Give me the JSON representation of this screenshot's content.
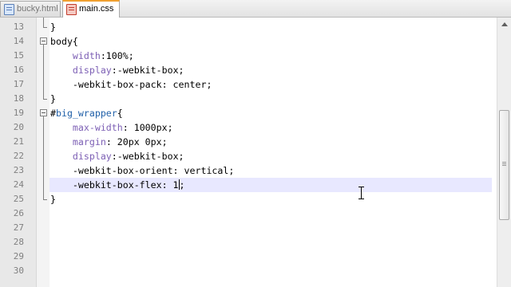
{
  "tabs": [
    {
      "label": "bucky.html",
      "active": false
    },
    {
      "label": "main.css",
      "active": true
    }
  ],
  "editor": {
    "lines": [
      {
        "num": "13",
        "parts": [
          {
            "t": "}",
            "c": "brace"
          }
        ]
      },
      {
        "num": "14",
        "parts": [
          {
            "t": "body",
            "c": "sel"
          },
          {
            "t": "{",
            "c": "brace"
          }
        ]
      },
      {
        "num": "15",
        "parts": [
          {
            "t": "    ",
            "c": "val"
          },
          {
            "t": "width",
            "c": "prop"
          },
          {
            "t": ":100%;",
            "c": "val"
          }
        ]
      },
      {
        "num": "16",
        "parts": [
          {
            "t": "    ",
            "c": "val"
          },
          {
            "t": "display",
            "c": "prop"
          },
          {
            "t": ":-webkit-box;",
            "c": "val"
          }
        ]
      },
      {
        "num": "17",
        "parts": [
          {
            "t": "    -webkit-box-pack: center;",
            "c": "val"
          }
        ]
      },
      {
        "num": "18",
        "parts": [
          {
            "t": "}",
            "c": "brace"
          }
        ]
      },
      {
        "num": "19",
        "parts": [
          {
            "t": "#",
            "c": "sel"
          },
          {
            "t": "big_wrapper",
            "c": "id"
          },
          {
            "t": "{",
            "c": "brace"
          }
        ]
      },
      {
        "num": "20",
        "parts": [
          {
            "t": "    ",
            "c": "val"
          },
          {
            "t": "max-width",
            "c": "prop"
          },
          {
            "t": ": 1000px;",
            "c": "val"
          }
        ]
      },
      {
        "num": "21",
        "parts": [
          {
            "t": "    ",
            "c": "val"
          },
          {
            "t": "margin",
            "c": "prop"
          },
          {
            "t": ": 20px 0px;",
            "c": "val"
          }
        ]
      },
      {
        "num": "22",
        "parts": [
          {
            "t": "    ",
            "c": "val"
          },
          {
            "t": "display",
            "c": "prop"
          },
          {
            "t": ":-webkit-box;",
            "c": "val"
          }
        ]
      },
      {
        "num": "23",
        "parts": [
          {
            "t": "    -webkit-box-orient: vertical;",
            "c": "val"
          }
        ]
      },
      {
        "num": "24",
        "parts": [
          {
            "t": "    -webkit-box-flex: 1",
            "c": "val"
          },
          {
            "t": "|",
            "c": "caret"
          },
          {
            "t": ";",
            "c": "val"
          }
        ],
        "current": true
      },
      {
        "num": "25",
        "parts": [
          {
            "t": "}",
            "c": "brace"
          }
        ]
      },
      {
        "num": "26",
        "parts": []
      },
      {
        "num": "27",
        "parts": []
      },
      {
        "num": "28",
        "parts": []
      },
      {
        "num": "29",
        "parts": []
      },
      {
        "num": "30",
        "parts": []
      }
    ]
  },
  "colors": {
    "property": "#7d60b5",
    "id_selector": "#1f5fa8",
    "current_line": "#e8e8ff",
    "active_tab_accent": "#f0a030"
  },
  "icons": {
    "tab_file": "file-icon",
    "scroll_up": "arrow-up-icon",
    "mouse": "text-cursor-icon"
  }
}
